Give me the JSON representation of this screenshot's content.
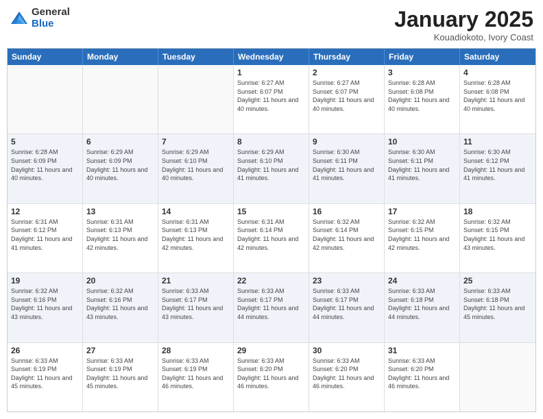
{
  "header": {
    "logo_general": "General",
    "logo_blue": "Blue",
    "title": "January 2025",
    "location": "Kouadiokoto, Ivory Coast"
  },
  "days_of_week": [
    "Sunday",
    "Monday",
    "Tuesday",
    "Wednesday",
    "Thursday",
    "Friday",
    "Saturday"
  ],
  "weeks": [
    [
      {
        "num": "",
        "info": ""
      },
      {
        "num": "",
        "info": ""
      },
      {
        "num": "",
        "info": ""
      },
      {
        "num": "1",
        "info": "Sunrise: 6:27 AM\nSunset: 6:07 PM\nDaylight: 11 hours and 40 minutes."
      },
      {
        "num": "2",
        "info": "Sunrise: 6:27 AM\nSunset: 6:07 PM\nDaylight: 11 hours and 40 minutes."
      },
      {
        "num": "3",
        "info": "Sunrise: 6:28 AM\nSunset: 6:08 PM\nDaylight: 11 hours and 40 minutes."
      },
      {
        "num": "4",
        "info": "Sunrise: 6:28 AM\nSunset: 6:08 PM\nDaylight: 11 hours and 40 minutes."
      }
    ],
    [
      {
        "num": "5",
        "info": "Sunrise: 6:28 AM\nSunset: 6:09 PM\nDaylight: 11 hours and 40 minutes."
      },
      {
        "num": "6",
        "info": "Sunrise: 6:29 AM\nSunset: 6:09 PM\nDaylight: 11 hours and 40 minutes."
      },
      {
        "num": "7",
        "info": "Sunrise: 6:29 AM\nSunset: 6:10 PM\nDaylight: 11 hours and 40 minutes."
      },
      {
        "num": "8",
        "info": "Sunrise: 6:29 AM\nSunset: 6:10 PM\nDaylight: 11 hours and 41 minutes."
      },
      {
        "num": "9",
        "info": "Sunrise: 6:30 AM\nSunset: 6:11 PM\nDaylight: 11 hours and 41 minutes."
      },
      {
        "num": "10",
        "info": "Sunrise: 6:30 AM\nSunset: 6:11 PM\nDaylight: 11 hours and 41 minutes."
      },
      {
        "num": "11",
        "info": "Sunrise: 6:30 AM\nSunset: 6:12 PM\nDaylight: 11 hours and 41 minutes."
      }
    ],
    [
      {
        "num": "12",
        "info": "Sunrise: 6:31 AM\nSunset: 6:12 PM\nDaylight: 11 hours and 41 minutes."
      },
      {
        "num": "13",
        "info": "Sunrise: 6:31 AM\nSunset: 6:13 PM\nDaylight: 11 hours and 42 minutes."
      },
      {
        "num": "14",
        "info": "Sunrise: 6:31 AM\nSunset: 6:13 PM\nDaylight: 11 hours and 42 minutes."
      },
      {
        "num": "15",
        "info": "Sunrise: 6:31 AM\nSunset: 6:14 PM\nDaylight: 11 hours and 42 minutes."
      },
      {
        "num": "16",
        "info": "Sunrise: 6:32 AM\nSunset: 6:14 PM\nDaylight: 11 hours and 42 minutes."
      },
      {
        "num": "17",
        "info": "Sunrise: 6:32 AM\nSunset: 6:15 PM\nDaylight: 11 hours and 42 minutes."
      },
      {
        "num": "18",
        "info": "Sunrise: 6:32 AM\nSunset: 6:15 PM\nDaylight: 11 hours and 43 minutes."
      }
    ],
    [
      {
        "num": "19",
        "info": "Sunrise: 6:32 AM\nSunset: 6:16 PM\nDaylight: 11 hours and 43 minutes."
      },
      {
        "num": "20",
        "info": "Sunrise: 6:32 AM\nSunset: 6:16 PM\nDaylight: 11 hours and 43 minutes."
      },
      {
        "num": "21",
        "info": "Sunrise: 6:33 AM\nSunset: 6:17 PM\nDaylight: 11 hours and 43 minutes."
      },
      {
        "num": "22",
        "info": "Sunrise: 6:33 AM\nSunset: 6:17 PM\nDaylight: 11 hours and 44 minutes."
      },
      {
        "num": "23",
        "info": "Sunrise: 6:33 AM\nSunset: 6:17 PM\nDaylight: 11 hours and 44 minutes."
      },
      {
        "num": "24",
        "info": "Sunrise: 6:33 AM\nSunset: 6:18 PM\nDaylight: 11 hours and 44 minutes."
      },
      {
        "num": "25",
        "info": "Sunrise: 6:33 AM\nSunset: 6:18 PM\nDaylight: 11 hours and 45 minutes."
      }
    ],
    [
      {
        "num": "26",
        "info": "Sunrise: 6:33 AM\nSunset: 6:19 PM\nDaylight: 11 hours and 45 minutes."
      },
      {
        "num": "27",
        "info": "Sunrise: 6:33 AM\nSunset: 6:19 PM\nDaylight: 11 hours and 45 minutes."
      },
      {
        "num": "28",
        "info": "Sunrise: 6:33 AM\nSunset: 6:19 PM\nDaylight: 11 hours and 46 minutes."
      },
      {
        "num": "29",
        "info": "Sunrise: 6:33 AM\nSunset: 6:20 PM\nDaylight: 11 hours and 46 minutes."
      },
      {
        "num": "30",
        "info": "Sunrise: 6:33 AM\nSunset: 6:20 PM\nDaylight: 11 hours and 46 minutes."
      },
      {
        "num": "31",
        "info": "Sunrise: 6:33 AM\nSunset: 6:20 PM\nDaylight: 11 hours and 46 minutes."
      },
      {
        "num": "",
        "info": ""
      }
    ]
  ],
  "alt_rows": [
    1,
    3
  ]
}
